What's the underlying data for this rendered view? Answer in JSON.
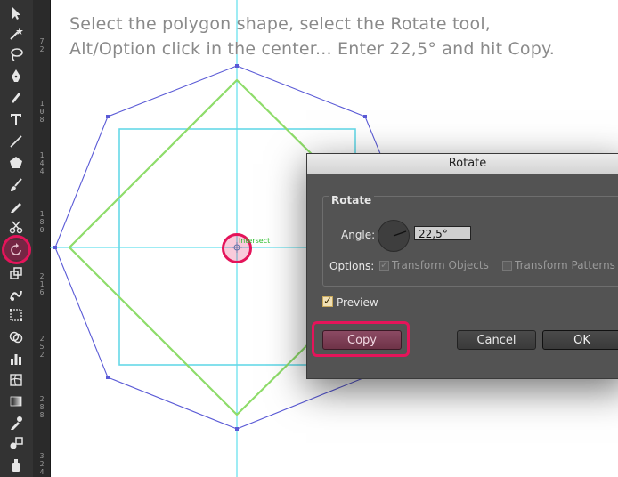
{
  "instruction": {
    "line1": "Select the polygon shape, select the Rotate tool,",
    "line2": "Alt/Option click in the center... Enter 22,5° and hit Copy."
  },
  "ruler": {
    "ticks": [
      "72",
      "108",
      "144",
      "180",
      "216",
      "252",
      "288",
      "324"
    ]
  },
  "tools": [
    "selection-tool-icon",
    "direct-selection-tool-icon",
    "magic-wand-tool-icon",
    "lasso-tool-icon",
    "pen-tool-icon",
    "curvature-tool-icon",
    "type-tool-icon",
    "line-tool-icon",
    "polygon-tool-icon",
    "paintbrush-tool-icon",
    "pencil-tool-icon",
    "eraser-tool-icon",
    "scissors-tool-icon",
    "rotate-tool-icon",
    "scale-tool-icon",
    "warp-tool-icon",
    "free-transform-tool-icon",
    "shape-builder-tool-icon",
    "graph-tool-icon",
    "mesh-tool-icon",
    "gradient-tool-icon",
    "eyedropper-tool-icon",
    "blend-tool-icon",
    "symbol-sprayer-tool-icon"
  ],
  "canvas": {
    "smart_guide_label": "intersect",
    "colors": {
      "polygon": "#5a5ad6",
      "diamond": "#8edc6a",
      "square": "#66d9e8",
      "guides": "#3fd8e8",
      "highlight": "#e4145a"
    }
  },
  "dialog": {
    "title": "Rotate",
    "group_label": "Rotate",
    "angle_label": "Angle:",
    "angle_value": "22,5°",
    "options_label": "Options:",
    "transform_objects_label": "Transform Objects",
    "transform_patterns_label": "Transform Patterns",
    "preview_label": "Preview",
    "copy_label": "Copy",
    "cancel_label": "Cancel",
    "ok_label": "OK"
  }
}
